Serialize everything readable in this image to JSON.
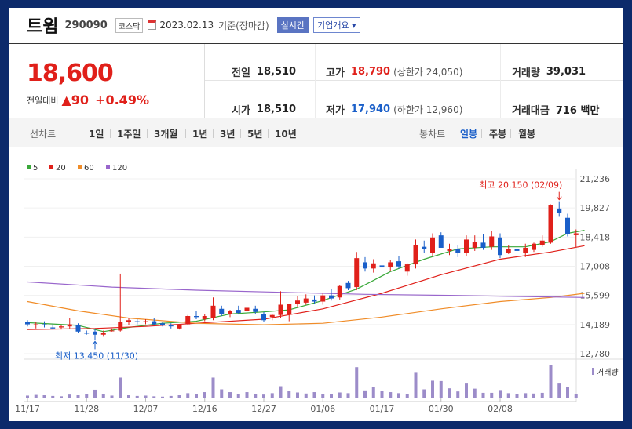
{
  "header": {
    "name": "트윔",
    "code": "290090",
    "market": "코스닥",
    "date": "2023.02.13",
    "basis": "기준(장마감)",
    "realtime": "실시간",
    "overview": "기업개요"
  },
  "price": {
    "current": "18,600",
    "diff_label": "전일대비",
    "diff": "▲90",
    "pct": "+0.49%"
  },
  "stats": {
    "prev_label": "전일",
    "prev": "18,510",
    "high_label": "고가",
    "high": "18,790",
    "upper": "(상한가 24,050)",
    "volume_label": "거래량",
    "volume": "39,031",
    "open_label": "시가",
    "open": "18,510",
    "low_label": "저가",
    "low": "17,940",
    "lower": "(하한가 12,960)",
    "amount_label": "거래대금",
    "amount": "716 백만"
  },
  "tabs": {
    "line_label": "선차트",
    "periods": [
      "1일",
      "1주일",
      "3개월",
      "1년",
      "3년",
      "5년",
      "10년"
    ],
    "candle_label": "봉차트",
    "candles": [
      "일봉",
      "주봉",
      "월봉"
    ],
    "selected_candle": "일봉"
  },
  "chart_data": {
    "type": "candlestick",
    "legend": [
      {
        "name": "5",
        "color": "#39a839"
      },
      {
        "name": "20",
        "color": "#e0201a"
      },
      {
        "name": "60",
        "color": "#f08c28"
      },
      {
        "name": "120",
        "color": "#9966cc"
      }
    ],
    "y_ticks": [
      "21,236",
      "19,827",
      "18,418",
      "17,008",
      "15,599",
      "14,189",
      "12,780"
    ],
    "ylim": [
      12780,
      21236
    ],
    "x_ticks": [
      {
        "label": "11/17",
        "i": 0
      },
      {
        "label": "11/28",
        "i": 7
      },
      {
        "label": "12/07",
        "i": 14
      },
      {
        "label": "12/16",
        "i": 21
      },
      {
        "label": "12/27",
        "i": 28
      },
      {
        "label": "01/06",
        "i": 35
      },
      {
        "label": "01/17",
        "i": 42
      },
      {
        "label": "01/30",
        "i": 49
      },
      {
        "label": "02/08",
        "i": 56
      }
    ],
    "max_annotation": "최고 20,150 (02/09)",
    "min_annotation": "최저 13,450 (11/30)",
    "volume_label": "거래량",
    "candles": [
      {
        "o": 14300,
        "h": 14400,
        "l": 14100,
        "c": 14200
      },
      {
        "o": 14150,
        "h": 14300,
        "l": 14000,
        "c": 14200
      },
      {
        "o": 14200,
        "h": 14350,
        "l": 14050,
        "c": 14150
      },
      {
        "o": 14050,
        "h": 14200,
        "l": 13950,
        "c": 14000
      },
      {
        "o": 14050,
        "h": 14150,
        "l": 13950,
        "c": 14100
      },
      {
        "o": 14100,
        "h": 14500,
        "l": 14000,
        "c": 14200
      },
      {
        "o": 14150,
        "h": 14250,
        "l": 13800,
        "c": 13850
      },
      {
        "o": 13800,
        "h": 13900,
        "l": 13700,
        "c": 13750
      },
      {
        "o": 13850,
        "h": 13950,
        "l": 13450,
        "c": 13700
      },
      {
        "o": 13700,
        "h": 13900,
        "l": 13600,
        "c": 13800
      },
      {
        "o": 13900,
        "h": 14000,
        "l": 13850,
        "c": 13900
      },
      {
        "o": 13900,
        "h": 16650,
        "l": 13850,
        "c": 14300
      },
      {
        "o": 14300,
        "h": 14500,
        "l": 14150,
        "c": 14400
      },
      {
        "o": 14350,
        "h": 14450,
        "l": 14200,
        "c": 14300
      },
      {
        "o": 14300,
        "h": 14450,
        "l": 14200,
        "c": 14350
      },
      {
        "o": 14350,
        "h": 14500,
        "l": 14150,
        "c": 14200
      },
      {
        "o": 14250,
        "h": 14300,
        "l": 14100,
        "c": 14150
      },
      {
        "o": 14150,
        "h": 14250,
        "l": 14000,
        "c": 14100
      },
      {
        "o": 14000,
        "h": 14200,
        "l": 13950,
        "c": 14150
      },
      {
        "o": 14200,
        "h": 14650,
        "l": 14150,
        "c": 14600
      },
      {
        "o": 14600,
        "h": 14850,
        "l": 14450,
        "c": 14550
      },
      {
        "o": 14450,
        "h": 14700,
        "l": 14350,
        "c": 14600
      },
      {
        "o": 14500,
        "h": 15500,
        "l": 14400,
        "c": 15100
      },
      {
        "o": 14950,
        "h": 15100,
        "l": 14600,
        "c": 14700
      },
      {
        "o": 14700,
        "h": 14900,
        "l": 14550,
        "c": 14850
      },
      {
        "o": 14900,
        "h": 15100,
        "l": 14700,
        "c": 14750
      },
      {
        "o": 14850,
        "h": 15250,
        "l": 14600,
        "c": 15000
      },
      {
        "o": 14950,
        "h": 15100,
        "l": 14700,
        "c": 14800
      },
      {
        "o": 14700,
        "h": 14800,
        "l": 14300,
        "c": 14400
      },
      {
        "o": 14550,
        "h": 14700,
        "l": 14400,
        "c": 14650
      },
      {
        "o": 14650,
        "h": 15800,
        "l": 14500,
        "c": 15150
      },
      {
        "o": 14700,
        "h": 15200,
        "l": 14350,
        "c": 15200
      },
      {
        "o": 15200,
        "h": 15550,
        "l": 15050,
        "c": 15350
      },
      {
        "o": 15250,
        "h": 15650,
        "l": 15150,
        "c": 15450
      },
      {
        "o": 15400,
        "h": 15600,
        "l": 15200,
        "c": 15300
      },
      {
        "o": 15300,
        "h": 15700,
        "l": 15150,
        "c": 15600
      },
      {
        "o": 15600,
        "h": 15900,
        "l": 15350,
        "c": 15450
      },
      {
        "o": 15500,
        "h": 16100,
        "l": 15400,
        "c": 16050
      },
      {
        "o": 16200,
        "h": 16300,
        "l": 15850,
        "c": 15950
      },
      {
        "o": 16000,
        "h": 17700,
        "l": 15850,
        "c": 17400
      },
      {
        "o": 17200,
        "h": 17450,
        "l": 16750,
        "c": 16900
      },
      {
        "o": 16900,
        "h": 17350,
        "l": 16700,
        "c": 17150
      },
      {
        "o": 17050,
        "h": 17200,
        "l": 16850,
        "c": 16950
      },
      {
        "o": 16950,
        "h": 17300,
        "l": 16800,
        "c": 17200
      },
      {
        "o": 17250,
        "h": 17500,
        "l": 16900,
        "c": 17000
      },
      {
        "o": 16750,
        "h": 17150,
        "l": 16550,
        "c": 17100
      },
      {
        "o": 17100,
        "h": 18300,
        "l": 16900,
        "c": 18050
      },
      {
        "o": 17950,
        "h": 18250,
        "l": 17650,
        "c": 17850
      },
      {
        "o": 17650,
        "h": 18600,
        "l": 17500,
        "c": 18400
      },
      {
        "o": 18500,
        "h": 18650,
        "l": 17950,
        "c": 17900
      },
      {
        "o": 17750,
        "h": 18100,
        "l": 17550,
        "c": 17850
      },
      {
        "o": 17850,
        "h": 18050,
        "l": 17450,
        "c": 17650
      },
      {
        "o": 17650,
        "h": 18500,
        "l": 17500,
        "c": 18300
      },
      {
        "o": 17900,
        "h": 18500,
        "l": 17750,
        "c": 18200
      },
      {
        "o": 18150,
        "h": 18550,
        "l": 17800,
        "c": 17900
      },
      {
        "o": 17950,
        "h": 18700,
        "l": 17800,
        "c": 18450
      },
      {
        "o": 18400,
        "h": 18600,
        "l": 17400,
        "c": 17550
      },
      {
        "o": 17650,
        "h": 18050,
        "l": 17600,
        "c": 17850
      },
      {
        "o": 17850,
        "h": 18050,
        "l": 17700,
        "c": 17750
      },
      {
        "o": 17650,
        "h": 18100,
        "l": 17450,
        "c": 17900
      },
      {
        "o": 17800,
        "h": 18150,
        "l": 17700,
        "c": 18100
      },
      {
        "o": 18050,
        "h": 18500,
        "l": 17950,
        "c": 18250
      },
      {
        "o": 18150,
        "h": 20000,
        "l": 18100,
        "c": 19950
      },
      {
        "o": 19800,
        "h": 20150,
        "l": 19400,
        "c": 19600
      },
      {
        "o": 19350,
        "h": 19550,
        "l": 18450,
        "c": 18550
      },
      {
        "o": 18510,
        "h": 18790,
        "l": 17940,
        "c": 18600
      }
    ],
    "ma": {
      "5": [
        [
          0,
          14280
        ],
        [
          6,
          14150
        ],
        [
          9,
          13850
        ],
        [
          12,
          14050
        ],
        [
          16,
          14250
        ],
        [
          20,
          14350
        ],
        [
          24,
          14700
        ],
        [
          28,
          14800
        ],
        [
          31,
          14900
        ],
        [
          35,
          15350
        ],
        [
          39,
          15900
        ],
        [
          43,
          16750
        ],
        [
          47,
          17350
        ],
        [
          51,
          17850
        ],
        [
          55,
          17950
        ],
        [
          59,
          17950
        ],
        [
          62,
          18200
        ],
        [
          64,
          18600
        ],
        [
          66,
          18750
        ]
      ],
      "20": [
        [
          0,
          13950
        ],
        [
          8,
          14000
        ],
        [
          14,
          14100
        ],
        [
          20,
          14250
        ],
        [
          28,
          14450
        ],
        [
          35,
          14950
        ],
        [
          42,
          15700
        ],
        [
          49,
          16600
        ],
        [
          56,
          17350
        ],
        [
          62,
          17700
        ],
        [
          66,
          18000
        ]
      ],
      "60": [
        [
          0,
          15300
        ],
        [
          6,
          14850
        ],
        [
          12,
          14500
        ],
        [
          20,
          14250
        ],
        [
          28,
          14180
        ],
        [
          35,
          14250
        ],
        [
          42,
          14550
        ],
        [
          49,
          14950
        ],
        [
          56,
          15300
        ],
        [
          62,
          15500
        ],
        [
          66,
          15700
        ]
      ],
      "120": [
        [
          0,
          16250
        ],
        [
          10,
          16000
        ],
        [
          20,
          15850
        ],
        [
          30,
          15750
        ],
        [
          40,
          15650
        ],
        [
          50,
          15600
        ],
        [
          58,
          15550
        ],
        [
          66,
          15500
        ]
      ]
    },
    "volume": [
      800,
      1000,
      900,
      700,
      600,
      1100,
      900,
      1300,
      2500,
      1200,
      800,
      6000,
      900,
      700,
      800,
      600,
      500,
      700,
      900,
      1500,
      1300,
      1800,
      6000,
      2600,
      1800,
      1300,
      1800,
      1200,
      1100,
      1500,
      3500,
      2200,
      1700,
      1400,
      1800,
      1300,
      1300,
      1700,
      1500,
      9000,
      2300,
      3300,
      2100,
      1800,
      1500,
      1300,
      7600,
      2600,
      5100,
      5000,
      2900,
      2000,
      4500,
      2800,
      1600,
      1600,
      2400,
      1500,
      1200,
      1500,
      1400,
      1600,
      9500,
      4500,
      3300,
      1300
    ]
  }
}
